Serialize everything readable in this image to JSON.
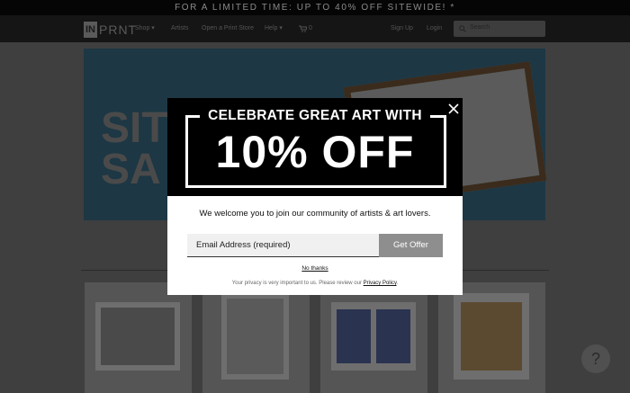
{
  "promo_bar": {
    "text": "FOR A LIMITED TIME: UP TO 40% OFF SITEWIDE! *"
  },
  "nav": {
    "logo_in": "IN",
    "logo_prnt": "PRNT",
    "items": [
      {
        "label": "Shop ▾"
      },
      {
        "label": "Artists"
      },
      {
        "label": "Open a Print Store"
      },
      {
        "label": "Help ▾"
      },
      {
        "label": "0"
      },
      {
        "label": "Sign Up"
      },
      {
        "label": "Login"
      }
    ],
    "search": {
      "placeholder": "Search"
    }
  },
  "banner": {
    "text_line1": "SITE",
    "text_line2": "SA"
  },
  "help_button": {
    "label": "?"
  },
  "modal": {
    "heading": "CELEBRATE GREAT ART WITH",
    "big_text": "10% OFF",
    "welcome": "We welcome you to join our community of artists & art lovers.",
    "email_placeholder": "Email Address (required)",
    "submit_label": "Get Offer",
    "no_thanks": "No thanks",
    "privacy_text": "Your privacy is very important to us. Please review our ",
    "privacy_link": "Privacy Policy",
    "privacy_end": "."
  }
}
